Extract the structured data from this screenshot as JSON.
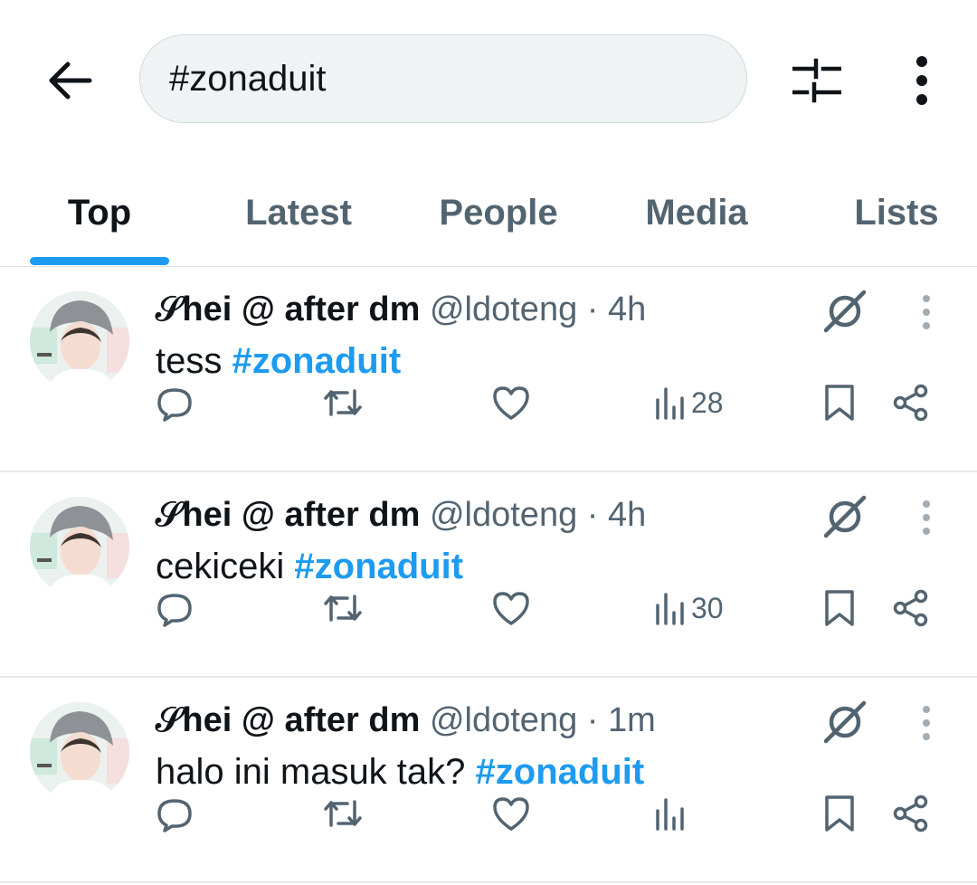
{
  "search": {
    "query": "#zonaduit"
  },
  "icons": {
    "back": "arrow-left-icon",
    "filter": "sliders-icon",
    "more": "more-vertical-icon",
    "grok": "grok-icon",
    "reply": "reply-icon",
    "retweet": "retweet-icon",
    "like": "heart-icon",
    "views": "views-icon",
    "bookmark": "bookmark-icon",
    "share": "share-icon"
  },
  "colors": {
    "accent": "#1d9bf0",
    "text_primary": "#0f1419",
    "text_secondary": "#536471",
    "search_bg": "#eff3f4"
  },
  "tabs": [
    {
      "label": "Top",
      "active": true
    },
    {
      "label": "Latest",
      "active": false
    },
    {
      "label": "People",
      "active": false
    },
    {
      "label": "Media",
      "active": false
    },
    {
      "label": "Lists",
      "active": false
    }
  ],
  "tweets": [
    {
      "display_name": "𝒮hei @ after dm",
      "handle": "@ldoteng",
      "separator": "·",
      "time": "4h",
      "text": "tess ",
      "hashtag": "#zonaduit",
      "views": "28"
    },
    {
      "display_name": "𝒮hei @ after dm",
      "handle": "@ldoteng",
      "separator": "·",
      "time": "4h",
      "text": "cekiceki ",
      "hashtag": "#zonaduit",
      "views": "30"
    },
    {
      "display_name": "𝒮hei @ after dm",
      "handle": "@ldoteng",
      "separator": "·",
      "time": "1m",
      "text": "halo ini masuk tak? ",
      "hashtag": "#zonaduit",
      "views": ""
    }
  ]
}
